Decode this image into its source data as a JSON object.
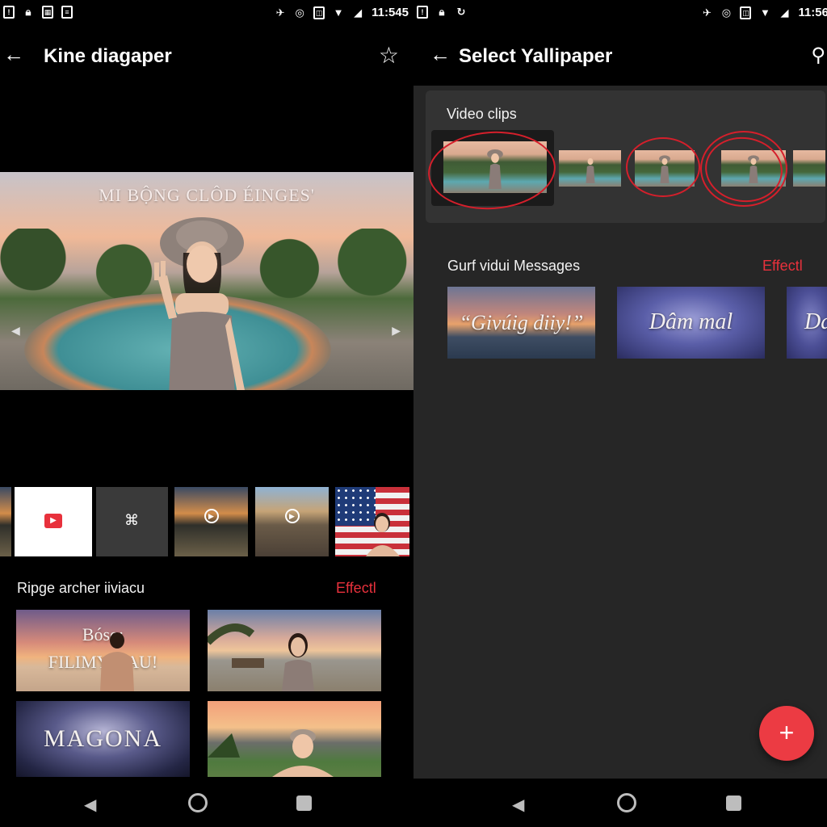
{
  "colors": {
    "accent": "#e8313c",
    "fab": "#ec3b43",
    "panel_dark": "#262626"
  },
  "left": {
    "status": {
      "time": "11:545"
    },
    "appbar": {
      "title": "Kine diagaper",
      "back_icon": "arrow-left-icon",
      "action_icon": "star-icon"
    },
    "hero": {
      "caption": "MI BỘNG CLÔD ÉINGES'"
    },
    "strip_icons": {
      "first": "video-camera-icon",
      "second": "puzzle-icon"
    },
    "section": {
      "title": "Ripge archer iiviacu",
      "effect": "Effectl"
    },
    "cards": [
      {
        "text": "Bósọ: FILIMY HAU!"
      },
      {
        "text": ""
      },
      {
        "text": "MAGONA"
      },
      {
        "text": ""
      }
    ]
  },
  "right": {
    "status": {
      "time": "11:56"
    },
    "appbar": {
      "title": "Select Yallipaper",
      "back_icon": "arrow-left-icon",
      "action_icon": "search-icon"
    },
    "clips": {
      "title": "Video clips"
    },
    "messages": {
      "title": "Gurf vidui Messages",
      "effect": "Effectl",
      "cards": [
        {
          "text": "“Givúig diiy!”"
        },
        {
          "text": "Dâm mal"
        },
        {
          "text": "Da"
        }
      ]
    },
    "fab": {
      "label": "+"
    }
  }
}
